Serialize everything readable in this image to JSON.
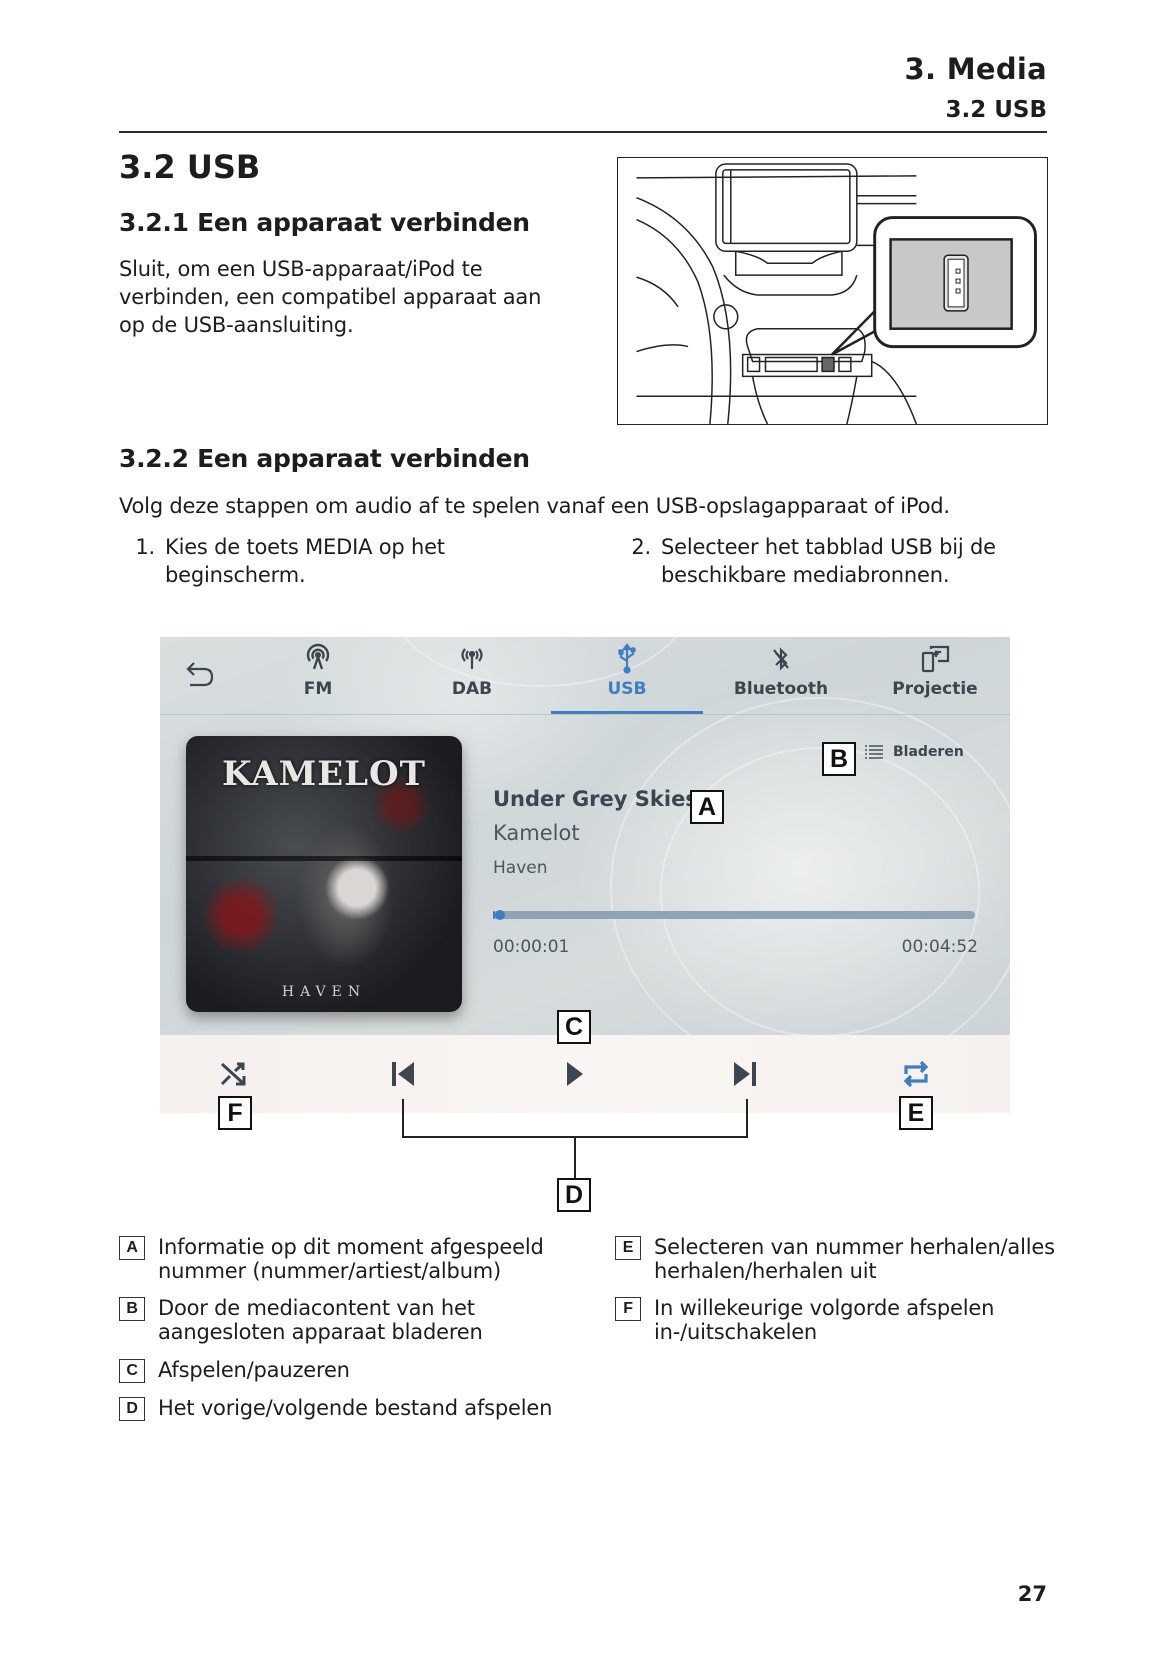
{
  "header": {
    "chapter": "3.  Media",
    "section": "3.2  USB"
  },
  "section_title": "3.2  USB",
  "subsection_1": {
    "title": "3.2.1  Een apparaat verbinden",
    "text": "Sluit, om een USB-apparaat/iPod te verbinden, een compatibel apparaat aan op de USB-aansluiting."
  },
  "illustration": {
    "subject": "dashboard with USB port callout",
    "icon": "usb-port-icon"
  },
  "subsection_2": {
    "title": "3.2.2  Een apparaat verbinden",
    "lead": "Volg deze stappen om audio af te spelen vanaf een USB-opslagapparaat of iPod.",
    "steps": [
      {
        "num": "1.",
        "text": "Kies de toets MEDIA op het beginscherm."
      },
      {
        "num": "2.",
        "text": "Selecteer het tabblad USB bij de beschikbare mediabronnen."
      }
    ]
  },
  "media_screen": {
    "back_icon": "back-arrow-icon",
    "tabs": [
      {
        "label": "FM",
        "icon": "fm-antenna-icon",
        "active": false
      },
      {
        "label": "DAB",
        "icon": "dab-broadcast-icon",
        "active": false
      },
      {
        "label": "USB",
        "icon": "usb-icon",
        "active": true
      },
      {
        "label": "Bluetooth",
        "icon": "bluetooth-off-icon",
        "active": false
      },
      {
        "label": "Projectie",
        "icon": "projection-icon",
        "active": false
      }
    ],
    "album_art": {
      "logo": "KAMELOT",
      "subtitle": "HAVEN"
    },
    "browse_label": "Bladeren",
    "track": {
      "title": "Under Grey Skies",
      "artist": "Kamelot",
      "album": "Haven"
    },
    "progress": {
      "elapsed": "00:00:01",
      "total": "00:04:52",
      "fraction": 0.0034
    },
    "controls": [
      "shuffle-icon",
      "previous-track-icon",
      "play-icon",
      "next-track-icon",
      "repeat-icon"
    ],
    "accent_color": "#3f7fc0",
    "text_color": "#3a4651"
  },
  "callouts": {
    "A": "A",
    "B": "B",
    "C": "C",
    "D": "D",
    "E": "E",
    "F": "F"
  },
  "legend": [
    {
      "key": "A",
      "text": "Informatie op dit moment afgespeeld nummer (nummer/artiest/album)"
    },
    {
      "key": "B",
      "text": "Door de mediacontent van het aangesloten apparaat bladeren"
    },
    {
      "key": "C",
      "text": "Afspelen/pauzeren"
    },
    {
      "key": "D",
      "text": "Het vorige/volgende bestand afspelen"
    },
    {
      "key": "E",
      "text": "Selecteren van nummer herhalen/alles herhalen/herhalen uit"
    },
    {
      "key": "F",
      "text": "In willekeurige volgorde afspelen in-/uitschakelen"
    }
  ],
  "page_number": "27"
}
